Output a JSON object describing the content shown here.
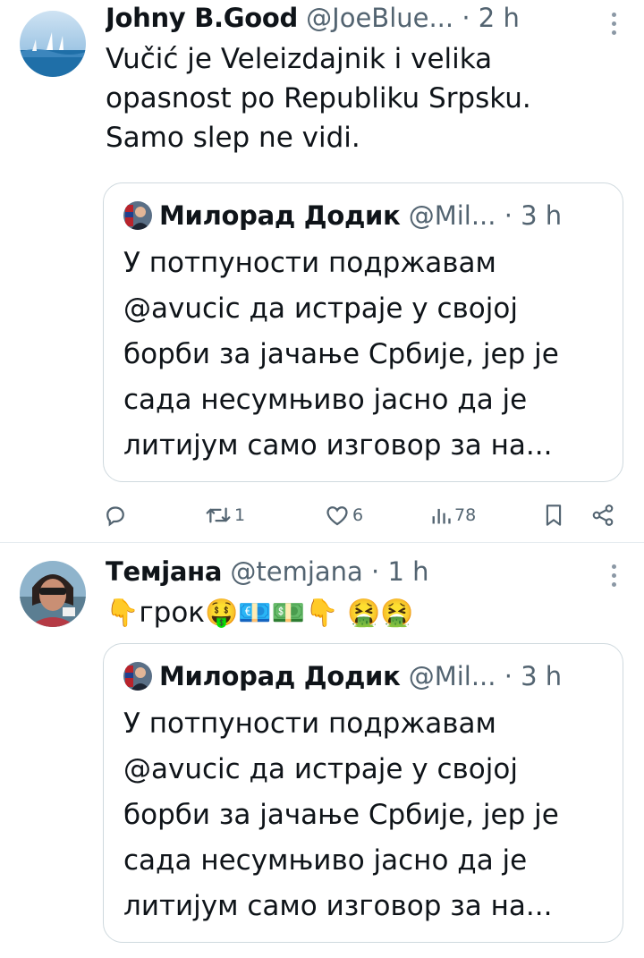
{
  "tweets": [
    {
      "name": "Johny B.Good",
      "handle": "@JoeBlue...",
      "sep": " · ",
      "time": "2 h",
      "text_lines": [
        "Vučić je Veleizdajnik i velika",
        "opasnost po Republiku Srpsku.",
        "Samo slep ne vidi."
      ],
      "quote": {
        "name": "Милорад Додик",
        "handle": "@Mil...",
        "sep": " · ",
        "time": "3 h",
        "lines": [
          "У потпуности подржавам",
          "@avucic да истраје у својој",
          "борби за јачање Србије, јер је",
          "сада несумњиво јасно да је",
          "литијум само изговор за на..."
        ]
      },
      "actions": {
        "reply_icon": "reply-icon",
        "retweet_icon": "retweet-icon",
        "retweet_count": "1",
        "like_icon": "heart-icon",
        "like_count": "6",
        "views_icon": "views-icon",
        "views_count": "78",
        "bookmark_icon": "bookmark-icon",
        "share_icon": "share-icon"
      }
    },
    {
      "name": "Темјана",
      "handle": "@temjana",
      "sep": " · ",
      "time": "1 h",
      "text_parts": [
        "👇",
        "грок",
        "🤑💶💵👇 🤮🤮"
      ],
      "quote": {
        "name": "Милорад Додик",
        "handle": "@Mil...",
        "sep": " · ",
        "time": "3 h",
        "lines": [
          "У потпуности подржавам",
          "@avucic да истраје у својој",
          "борби за јачање Србије, јер је",
          "сада несумњиво јасно да је",
          "литијум само изговор за на..."
        ]
      }
    }
  ],
  "colors": {
    "text": "#0f1419",
    "secondary": "#536471",
    "border": "#cfd9de",
    "divider": "#e6ecf0"
  }
}
